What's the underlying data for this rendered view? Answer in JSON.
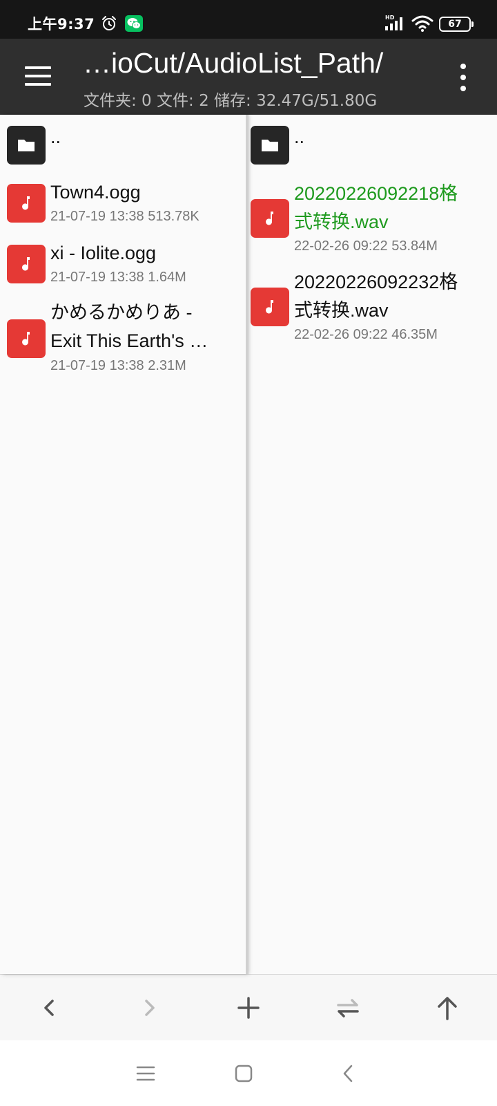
{
  "status_bar": {
    "time": "上午9:37",
    "network_label": "HD",
    "battery": "67",
    "icons": [
      "alarm-icon",
      "wechat-icon",
      "signal-icon",
      "wifi-icon",
      "battery-icon"
    ]
  },
  "toolbar": {
    "title": "…ioCut/AudioList_Path/",
    "subtitle": "文件夹: 0  文件: 2  储存: 32.47G/51.80G"
  },
  "left_pane": {
    "parent": {
      "name": ".."
    },
    "files": [
      {
        "name": "Town4.ogg",
        "meta": "21-07-19 13:38  513.78K"
      },
      {
        "name": "xi - Iolite.ogg",
        "meta": "21-07-19 13:38  1.64M"
      },
      {
        "name_line1": "かめるかめりあ -",
        "name_line2": "Exit This Earth's …",
        "meta": "21-07-19 13:38  2.31M"
      }
    ]
  },
  "right_pane": {
    "parent": {
      "name": ".."
    },
    "files": [
      {
        "name_line1": "20220226092218格",
        "name_line2": "式转换.wav",
        "meta": "22-02-26 09:22  53.84M",
        "selected": true
      },
      {
        "name_line1": "20220226092232格",
        "name_line2": "式转换.wav",
        "meta": "22-02-26 09:22  46.35M",
        "selected": false
      }
    ]
  },
  "colors": {
    "toolbar_bg": "#2f2f2f",
    "audio_icon": "#e53935",
    "folder_icon": "#262626",
    "selected_text": "#1e9a1e"
  },
  "action_bar_icons": [
    "back-chevron-icon",
    "forward-chevron-icon",
    "plus-icon",
    "swap-arrows-icon",
    "up-arrow-icon"
  ],
  "nav_bar_icons": [
    "menu-lines-icon",
    "home-square-icon",
    "back-triangle-icon"
  ]
}
